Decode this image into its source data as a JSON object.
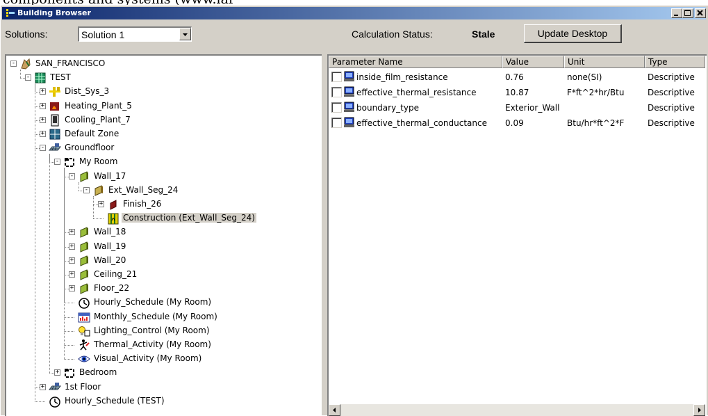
{
  "document_text": "components   and   systems   (www.lar",
  "window": {
    "title": "Building Browser",
    "title_bar_colors": [
      "#0a246a",
      "#a6caf0"
    ]
  },
  "toolbar": {
    "solutions_label": "Solutions:",
    "solution_value": "Solution 1",
    "calc_status_label": "Calculation Status:",
    "calc_status_value": "Stale",
    "update_button": "Update Desktop"
  },
  "tree": {
    "nodes": [
      {
        "label": "SAN_FRANCISCO",
        "icon": "city-icon",
        "expander": "-"
      },
      {
        "label": "TEST",
        "icon": "building-icon",
        "expander": "-"
      },
      {
        "label": "Dist_Sys_3",
        "icon": "distribution-system-icon",
        "expander": "+"
      },
      {
        "label": "Heating_Plant_5",
        "icon": "heating-plant-icon",
        "expander": "+"
      },
      {
        "label": "Cooling_Plant_7",
        "icon": "cooling-plant-icon",
        "expander": "+"
      },
      {
        "label": "Default Zone",
        "icon": "zone-icon",
        "expander": "+"
      },
      {
        "label": "Groundfloor",
        "icon": "floor-level-icon",
        "expander": "-"
      },
      {
        "label": "My Room",
        "icon": "room-icon",
        "expander": "-"
      },
      {
        "label": "Wall_17",
        "icon": "wall-icon",
        "expander": "-"
      },
      {
        "label": "Ext_Wall_Seg_24",
        "icon": "wall-segment-icon",
        "expander": "-"
      },
      {
        "label": "Finish_26",
        "icon": "finish-icon",
        "expander": "+"
      },
      {
        "label": "Construction (Ext_Wall_Seg_24)",
        "icon": "construction-icon",
        "expander": ""
      },
      {
        "label": "Wall_18",
        "icon": "wall-icon",
        "expander": "+"
      },
      {
        "label": "Wall_19",
        "icon": "wall-icon",
        "expander": "+"
      },
      {
        "label": "Wall_20",
        "icon": "wall-icon",
        "expander": "+"
      },
      {
        "label": "Ceiling_21",
        "icon": "ceiling-icon",
        "expander": "+"
      },
      {
        "label": "Floor_22",
        "icon": "floor-icon",
        "expander": "+"
      },
      {
        "label": "Hourly_Schedule (My Room)",
        "icon": "clock-icon",
        "expander": ""
      },
      {
        "label": "Monthly_Schedule (My Room)",
        "icon": "calendar-icon",
        "expander": ""
      },
      {
        "label": "Lighting_Control (My Room)",
        "icon": "lighting-control-icon",
        "expander": ""
      },
      {
        "label": "Thermal_Activity (My Room)",
        "icon": "thermal-activity-icon",
        "expander": ""
      },
      {
        "label": "Visual_Activity (My Room)",
        "icon": "eye-icon",
        "expander": ""
      },
      {
        "label": "Bedroom",
        "icon": "room-icon",
        "expander": "+"
      },
      {
        "label": "1st Floor",
        "icon": "floor-level-icon",
        "expander": "+"
      },
      {
        "label": "Hourly_Schedule (TEST)",
        "icon": "clock-icon",
        "expander": ""
      }
    ],
    "selected": "Construction (Ext_Wall_Seg_24)"
  },
  "grid": {
    "headers": [
      "Parameter Name",
      "Value",
      "Unit",
      "Type"
    ],
    "rows": [
      {
        "name": "inside_film_resistance",
        "value": "0.76",
        "unit": "none(SI)",
        "type": "Descriptive"
      },
      {
        "name": "effective_thermal_resistance",
        "value": "10.87",
        "unit": "F*ft^2*hr/Btu",
        "type": "Descriptive"
      },
      {
        "name": "boundary_type",
        "value": "Exterior_Wall",
        "unit": "",
        "type": "Descriptive"
      },
      {
        "name": "effective_thermal_conductance",
        "value": "0.09",
        "unit": "Btu/hr*ft^2*F",
        "type": "Descriptive"
      }
    ]
  },
  "colors": {
    "window_face": "#d4d0c8",
    "selection": "#d4d0c8"
  }
}
